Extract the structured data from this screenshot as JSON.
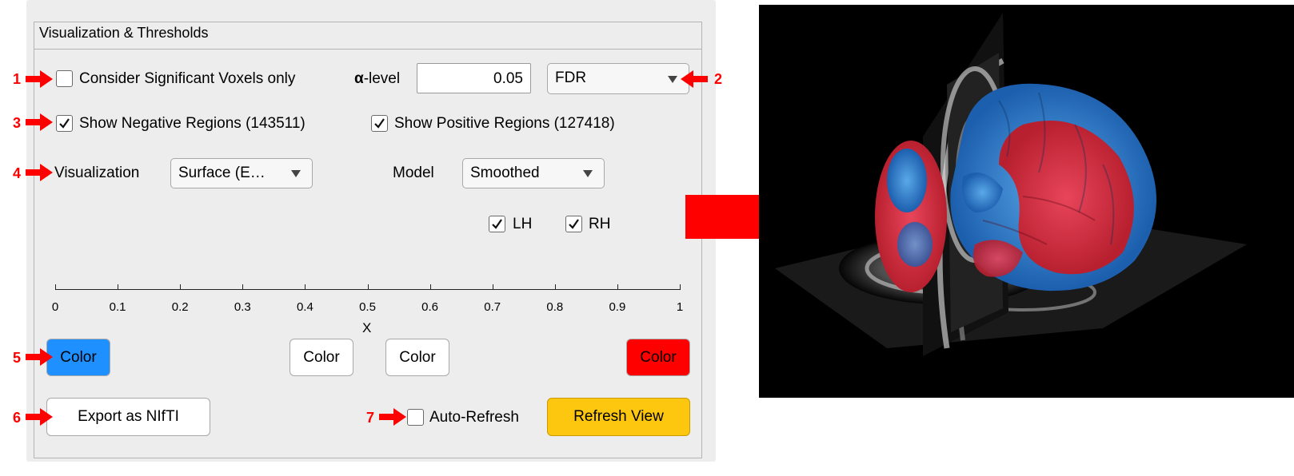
{
  "panel": {
    "title": "Visualization & Thresholds",
    "significance_checkbox": {
      "label": "Consider Significant Voxels only",
      "checked": false
    },
    "alpha": {
      "prefix": "α",
      "label": "-level",
      "value": "0.05"
    },
    "correction": {
      "selected": "FDR"
    },
    "negative_regions": {
      "label": "Show Negative Regions (143511)",
      "checked": true
    },
    "positive_regions": {
      "label": "Show Positive Regions (127418)",
      "checked": true
    },
    "visualization": {
      "label": "Visualization",
      "selected": "Surface (E…"
    },
    "model": {
      "label": "Model",
      "selected": "Smoothed"
    },
    "hemispheres": [
      {
        "label": "LH",
        "checked": true
      },
      {
        "label": "RH",
        "checked": true
      }
    ],
    "axis": {
      "ticks": [
        "0",
        "0.1",
        "0.2",
        "0.3",
        "0.4",
        "0.5",
        "0.6",
        "0.7",
        "0.8",
        "0.9",
        "1"
      ],
      "label": "X"
    },
    "color_buttons": [
      {
        "label": "Color",
        "color": "#1e90ff"
      },
      {
        "label": "Color",
        "color": "#ffffff"
      },
      {
        "label": "Color",
        "color": "#ffffff"
      },
      {
        "label": "Color",
        "color": "#ff0000"
      }
    ],
    "export_button": "Export as NIfTI",
    "auto_refresh": {
      "label": "Auto-Refresh",
      "checked": false
    },
    "refresh_button": {
      "label": "Refresh View",
      "color": "#fec70f"
    }
  },
  "annotations": [
    "1",
    "2",
    "3",
    "4",
    "5",
    "6",
    "7"
  ],
  "colors": {
    "annotation": "#ff0000",
    "panel_bg": "#ededed"
  }
}
